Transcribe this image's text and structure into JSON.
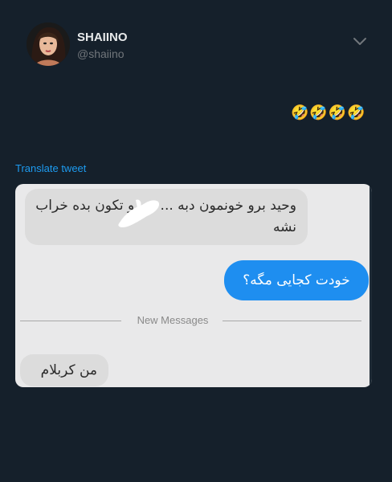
{
  "author": {
    "display_name": "SHAIINO",
    "handle": "@shaiino"
  },
  "tweet": {
    "text": "🤣🤣🤣🤣",
    "translate_label": "Translate tweet"
  },
  "icons": {
    "avatar": "avatar-image",
    "more_options": "chevron-down-icon",
    "censor_blot": "scribble-icon"
  },
  "chat_screenshot": {
    "incoming_1": "وحید برو خونمون دبه ... ی رو تکون بده خراب نشه",
    "outgoing_1": "خودت کجایی مگه؟",
    "divider_label": "New Messages",
    "incoming_2": "من کربلام"
  },
  "colors": {
    "background": "#15202b",
    "accent": "#1d9bf0",
    "outgoing_bubble": "#1e8ef0",
    "incoming_bubble": "#dcdcdc"
  }
}
